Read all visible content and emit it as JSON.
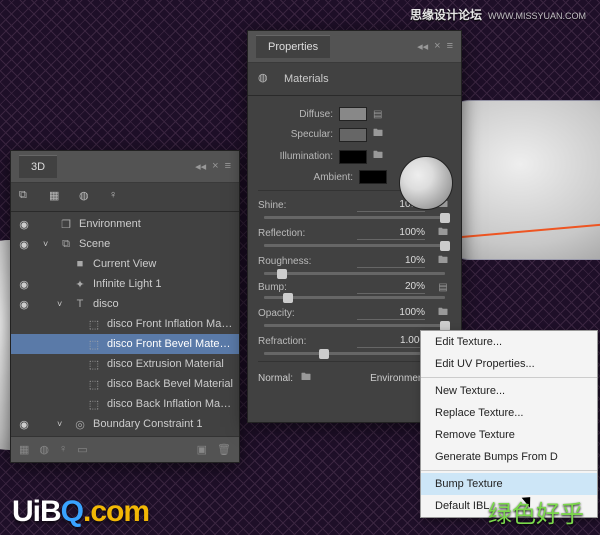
{
  "watermarks": {
    "top": "思缘设计论坛",
    "top_url": "WWW.MISSYUAN.COM",
    "bot_left_a": "UiB",
    "bot_left_b": "Q",
    "bot_left_c": ".com",
    "bot_right": "绿色好乎"
  },
  "panel3d": {
    "title": "3D",
    "rows": [
      {
        "eye": "◉",
        "indent": 0,
        "arrow": "",
        "icon": "❐",
        "label": "Environment",
        "sel": false
      },
      {
        "eye": "◉",
        "indent": 0,
        "arrow": "˅",
        "icon": "⧉",
        "label": "Scene",
        "sel": false
      },
      {
        "eye": "",
        "indent": 1,
        "arrow": "",
        "icon": "■",
        "label": "Current View",
        "sel": false
      },
      {
        "eye": "◉",
        "indent": 1,
        "arrow": "",
        "icon": "✦",
        "label": "Infinite Light 1",
        "sel": false
      },
      {
        "eye": "◉",
        "indent": 1,
        "arrow": "˅",
        "icon": "T",
        "label": "disco",
        "sel": false
      },
      {
        "eye": "",
        "indent": 2,
        "arrow": "",
        "icon": "⬚",
        "label": "disco Front Inflation Mat...",
        "sel": false
      },
      {
        "eye": "",
        "indent": 2,
        "arrow": "",
        "icon": "⬚",
        "label": "disco Front Bevel Material",
        "sel": true
      },
      {
        "eye": "",
        "indent": 2,
        "arrow": "",
        "icon": "⬚",
        "label": "disco Extrusion Material",
        "sel": false
      },
      {
        "eye": "",
        "indent": 2,
        "arrow": "",
        "icon": "⬚",
        "label": "disco Back Bevel Material",
        "sel": false
      },
      {
        "eye": "",
        "indent": 2,
        "arrow": "",
        "icon": "⬚",
        "label": "disco Back Inflation Mate...",
        "sel": false
      },
      {
        "eye": "◉",
        "indent": 1,
        "arrow": "˅",
        "icon": "◎",
        "label": "Boundary Constraint 1",
        "sel": false
      }
    ]
  },
  "props": {
    "title": "Properties",
    "subtitle": "Materials",
    "swatches": {
      "diffuse": "Diffuse:",
      "specular": "Specular:",
      "illumination": "Illumination:",
      "ambient": "Ambient:"
    },
    "sliders": [
      {
        "label": "Shine:",
        "val": "100%",
        "pos": 100
      },
      {
        "label": "Reflection:",
        "val": "100%",
        "pos": 100
      },
      {
        "label": "Roughness:",
        "val": "10%",
        "pos": 10
      },
      {
        "label": "Bump:",
        "val": "20%",
        "pos": 13
      },
      {
        "label": "Opacity:",
        "val": "100%",
        "pos": 100
      },
      {
        "label": "Refraction:",
        "val": "1.000",
        "pos": 33
      }
    ],
    "normal": "Normal:",
    "environment": "Environment:"
  },
  "menu": {
    "items": [
      {
        "label": "Edit Texture...",
        "sep": false
      },
      {
        "label": "Edit UV Properties...",
        "sep": true
      },
      {
        "label": "New Texture...",
        "sep": false
      },
      {
        "label": "Replace Texture...",
        "sep": false
      },
      {
        "label": "Remove Texture",
        "sep": false
      },
      {
        "label": "Generate Bumps From D",
        "sep": true
      },
      {
        "label": "Bump Texture",
        "sep": false,
        "hover": true
      },
      {
        "label": "Default IBL",
        "sep": false
      }
    ]
  }
}
